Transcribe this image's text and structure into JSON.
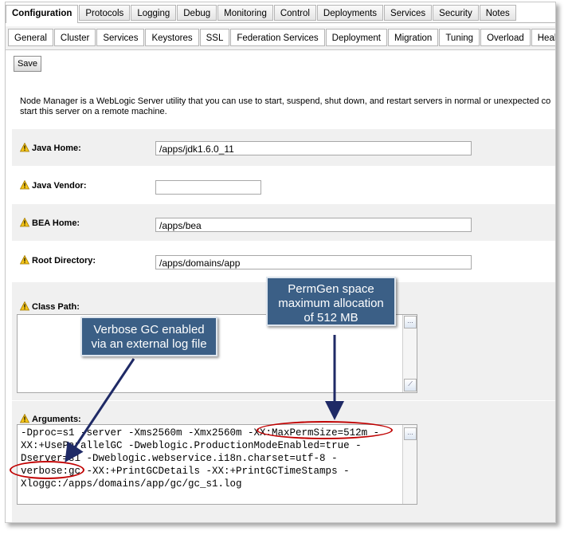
{
  "tabs_primary": [
    "Configuration",
    "Protocols",
    "Logging",
    "Debug",
    "Monitoring",
    "Control",
    "Deployments",
    "Services",
    "Security",
    "Notes"
  ],
  "tabs_secondary": [
    "General",
    "Cluster",
    "Services",
    "Keystores",
    "SSL",
    "Federation Services",
    "Deployment",
    "Migration",
    "Tuning",
    "Overload",
    "Health M"
  ],
  "save_label": "Save",
  "description_line1": "Node Manager is a WebLogic Server utility that you can use to start, suspend, shut down, and restart servers in normal or unexpected co",
  "description_line2": "start this server on a remote machine.",
  "fields": {
    "java_home": {
      "label": "Java Home:",
      "value": "/apps/jdk1.6.0_11"
    },
    "java_vendor": {
      "label": "Java Vendor:",
      "value": ""
    },
    "bea_home": {
      "label": "BEA Home:",
      "value": "/apps/bea"
    },
    "root_directory": {
      "label": "Root Directory:",
      "value": "/apps/domains/app"
    },
    "class_path": {
      "label": "Class Path:",
      "value": ""
    },
    "arguments": {
      "label": "Arguments:",
      "lines": [
        "-Dproc=s1 -server -Xms2560m -Xmx2560m -XX:MaxPermSize=512m -",
        "XX:+UseParallelGC -Dweblogic.ProductionModeEnabled=true -",
        "Dserver=s1 -Dweblogic.webservice.i18n.charset=utf-8 -",
        "verbose:gc -XX:+PrintGCDetails -XX:+PrintGCTimeStamps -",
        "Xloggc:/apps/domains/app/gc/gc_s1.log"
      ]
    }
  },
  "callouts": {
    "permgen": [
      "PermGen space",
      "maximum allocation",
      "of 512 MB"
    ],
    "verbose": [
      "Verbose GC enabled",
      "via an external log file"
    ]
  },
  "colors": {
    "callout_bg": "#3b5f86",
    "highlight": "#c00000",
    "arrow": "#1f2a66"
  }
}
